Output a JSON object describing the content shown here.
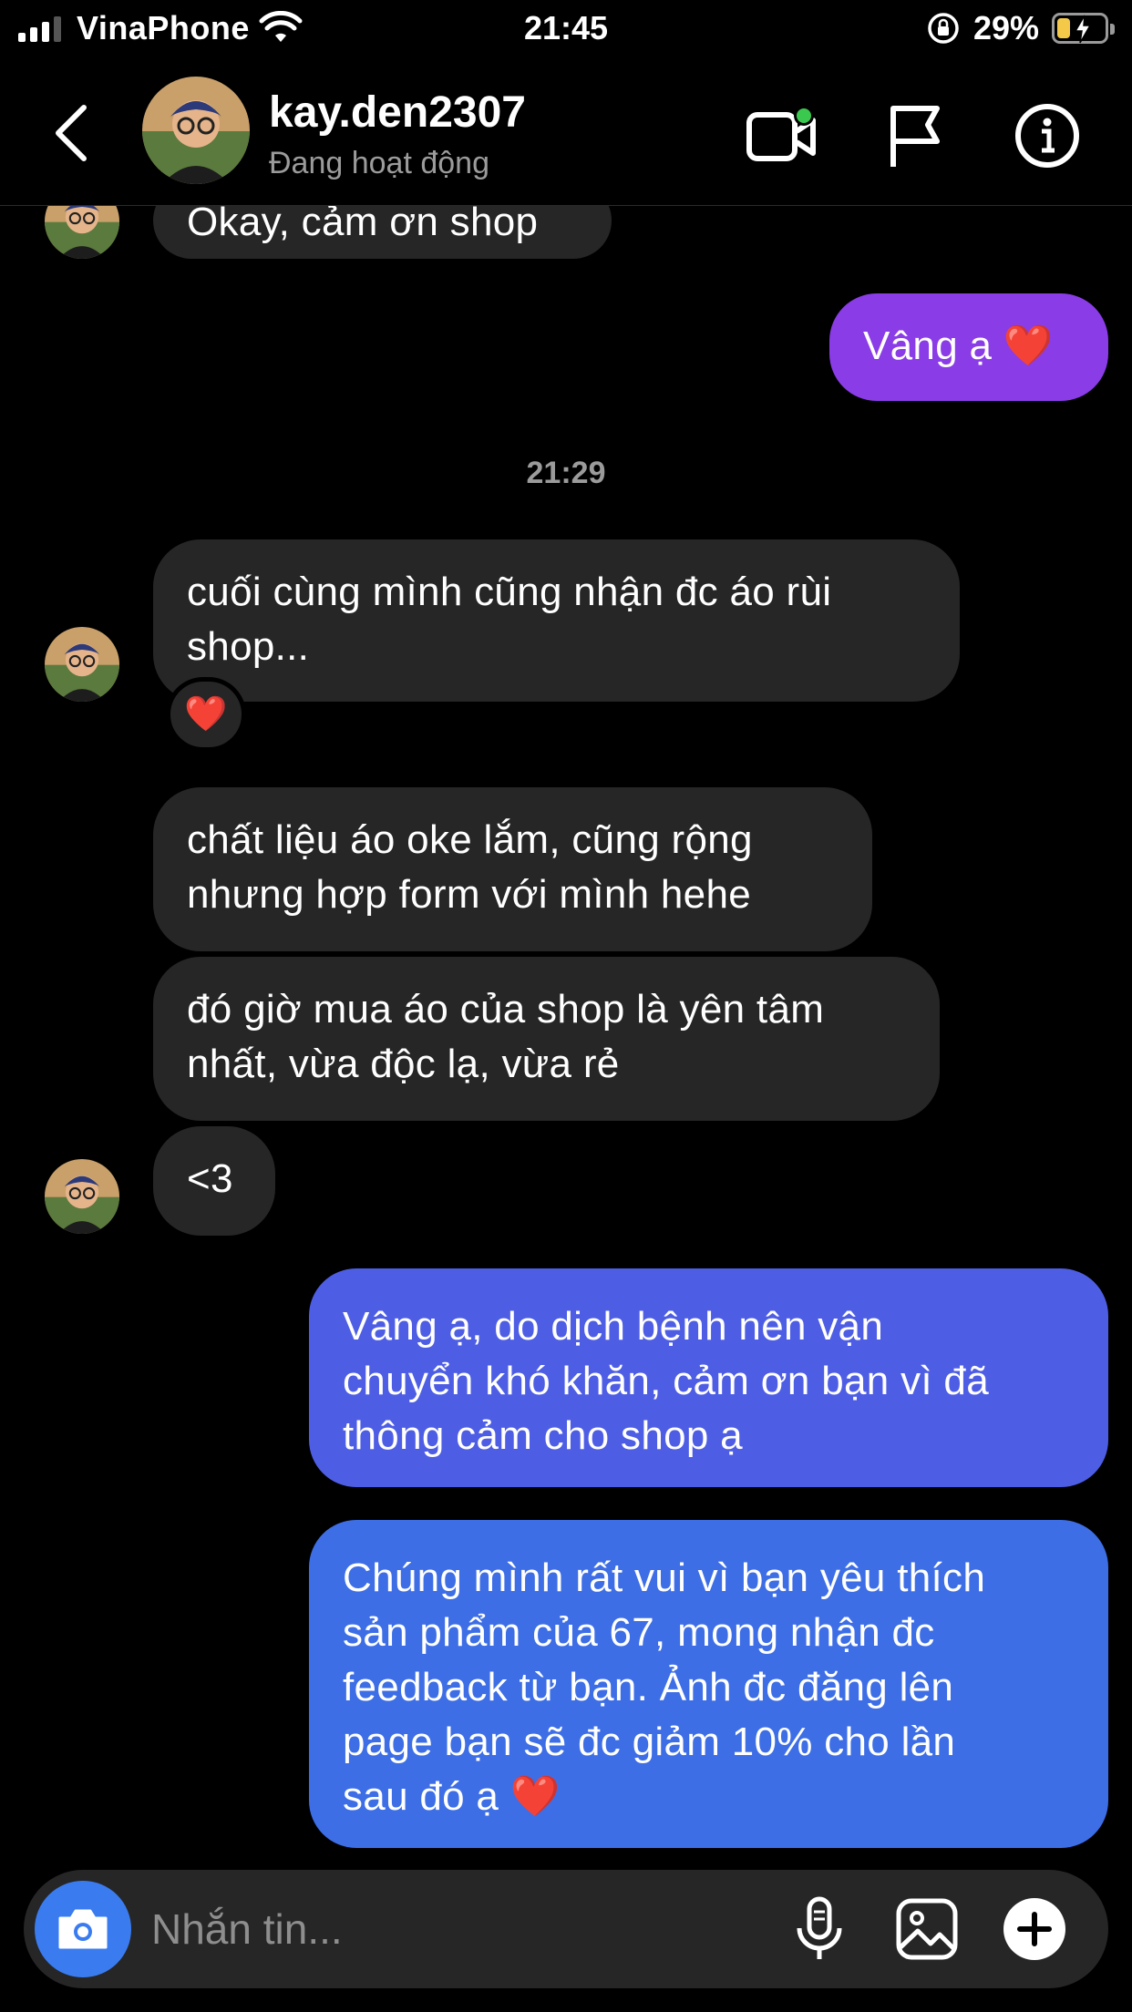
{
  "status_bar": {
    "carrier": "VinaPhone",
    "time": "21:45",
    "battery_percent": "29%",
    "battery_level": 0.29,
    "signal_bars": 3,
    "signal_max": 4
  },
  "header": {
    "username": "kay.den2307",
    "presence": "Đang hoạt động",
    "icons": {
      "back": "chevron-left-icon",
      "video": "video-call-icon",
      "flag": "flag-icon",
      "info": "info-icon"
    },
    "active_color": "#3ac94e"
  },
  "chat": {
    "messages": [
      {
        "from": "them",
        "text": "Okay, cảm ơn shop"
      },
      {
        "from": "me",
        "text": "Vâng ạ ❤️"
      },
      {
        "type": "timestamp",
        "text": "21:29"
      },
      {
        "from": "them",
        "text": "cuối cùng mình cũng nhận đc áo rùi\nshop...",
        "reaction": "❤️"
      },
      {
        "from": "them",
        "text": "chất liệu áo oke lắm, cũng rộng\nnhưng hợp form với mình hehe"
      },
      {
        "from": "them",
        "text": "đó giờ mua áo của shop là yên tâm\nnhất, vừa độc lạ, vừa rẻ"
      },
      {
        "from": "them",
        "text": "<3"
      },
      {
        "from": "me",
        "text": "Vâng ạ, do dịch bệnh nên vận\nchuyển khó khăn, cảm ơn bạn vì đã\nthông cảm cho shop ạ"
      },
      {
        "from": "me",
        "text": "Chúng mình rất vui vì bạn yêu thích\nsản phẩm của 67, mong nhận đc\nfeedback từ bạn. Ảnh đc đăng lên\npage bạn sẽ đc giảm 10% cho lần\nsau đó ạ ❤️"
      }
    ],
    "colors": {
      "incoming_bubble": "#262626",
      "outgoing_purple": "#8a3ce6",
      "outgoing_blue": "#3d6ee6"
    }
  },
  "composer": {
    "placeholder": "Nhắn tin...",
    "icons": {
      "camera": "camera-icon",
      "mic": "microphone-icon",
      "gallery": "image-gallery-icon",
      "plus": "plus-icon"
    },
    "camera_color": "#3a7cf0"
  }
}
